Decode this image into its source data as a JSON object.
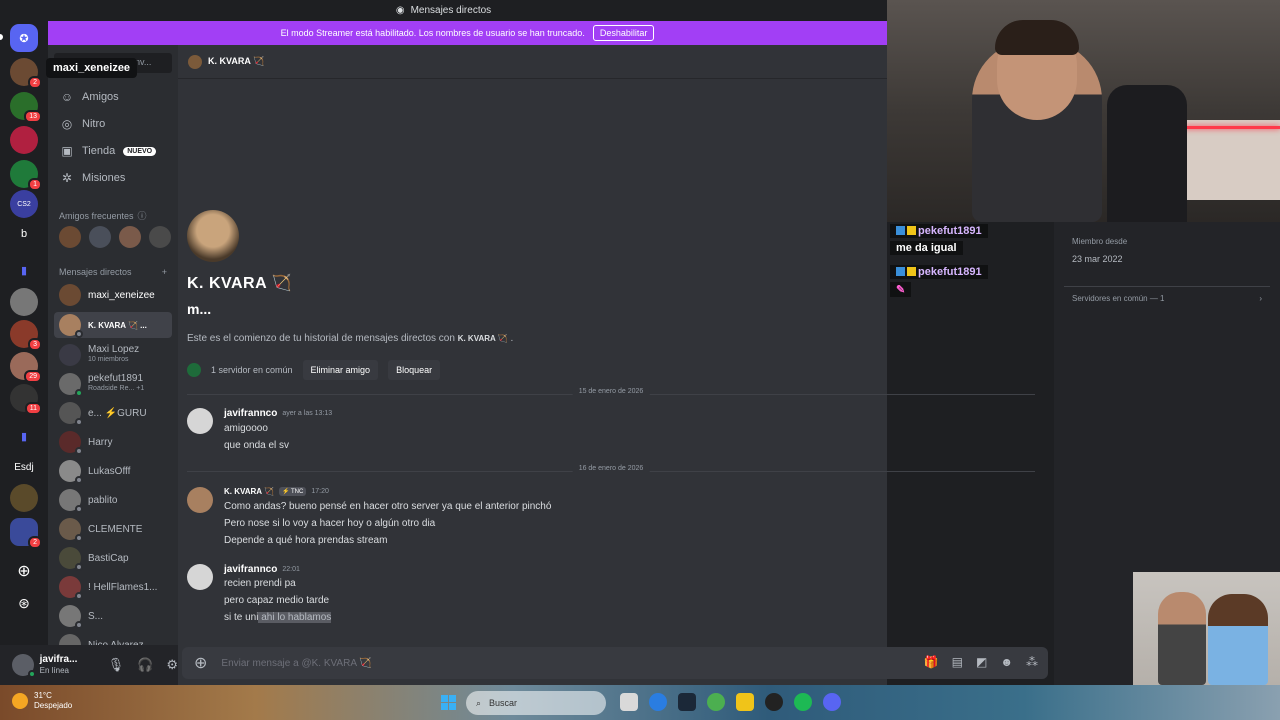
{
  "window": {
    "title": "Mensajes directos"
  },
  "banner": {
    "text": "El modo Streamer está habilitado. Los nombres de usuario se han truncado.",
    "button": "Deshabilitar"
  },
  "rail": {
    "tooltip": "maxi_xeneizee",
    "servers": [
      {
        "name": "discord-home",
        "badge": ""
      },
      {
        "name": "maxi_xeneizee",
        "badge": "2"
      },
      {
        "name": "guru",
        "badge": "13"
      },
      {
        "name": "server-3",
        "badge": ""
      },
      {
        "name": "server-4",
        "badge": "1"
      },
      {
        "name": "cs2",
        "badge": ""
      },
      {
        "name": "b",
        "label": "b",
        "badge": ""
      },
      {
        "name": "folder-1",
        "badge": ""
      },
      {
        "name": "server-8",
        "badge": ""
      },
      {
        "name": "server-9",
        "badge": "3"
      },
      {
        "name": "server-10",
        "badge": "29"
      },
      {
        "name": "server-11",
        "badge": "11"
      },
      {
        "name": "folder-2",
        "badge": ""
      },
      {
        "name": "esdj",
        "label": "Esdj",
        "badge": ""
      },
      {
        "name": "server-14",
        "badge": ""
      },
      {
        "name": "folder-3",
        "badge": "2"
      }
    ]
  },
  "sidebar": {
    "search_placeholder": "a conv...",
    "nav": [
      {
        "label": "Amigos",
        "icon": "friends-icon"
      },
      {
        "label": "Nitro",
        "icon": "nitro-icon"
      },
      {
        "label": "Tienda",
        "icon": "shop-icon",
        "badge": "NUEVO"
      },
      {
        "label": "Misiones",
        "icon": "quests-icon"
      }
    ],
    "frequent_title": "Amigos frecuentes",
    "dm_title": "Mensajes directos",
    "dms": [
      {
        "name": "maxi_xeneizee",
        "sub": ""
      },
      {
        "name": "K. KVARA 🏹 ...",
        "sub": "",
        "active": true
      },
      {
        "name": "Maxi Lopez",
        "sub": "10 miembros"
      },
      {
        "name": "pekefut1891",
        "sub": "Roadside Re... +1"
      },
      {
        "name": "e... ⚡GURU",
        "sub": ""
      },
      {
        "name": "Harry",
        "sub": ""
      },
      {
        "name": "LukasOfff",
        "sub": ""
      },
      {
        "name": "pablito",
        "sub": ""
      },
      {
        "name": "CLEMENTE",
        "sub": ""
      },
      {
        "name": "BastiCap",
        "sub": ""
      },
      {
        "name": "! HellFlames1...",
        "sub": ""
      },
      {
        "name": "S...",
        "sub": ""
      },
      {
        "name": "Nico Alvarez",
        "sub": ""
      }
    ]
  },
  "user": {
    "name": "javifra...",
    "status": "En línea"
  },
  "chat": {
    "header_name": "K. KVARA 🏹",
    "intro_name": "K. KVARA 🏹",
    "intro_sub": "m...",
    "intro_text_pre": "Este es el comienzo de tu historial de mensajes directos con",
    "intro_text_name": "K. KVARA 🏹",
    "intro_text_post": ".",
    "common_servers": "1 servidor en común",
    "remove_friend": "Eliminar amigo",
    "block": "Bloquear",
    "date1": "15 de enero de 2026",
    "date2": "16 de enero de 2026",
    "messages": [
      {
        "user": "javifrannco",
        "time": "ayer a las 13:13",
        "tag": "",
        "lines": [
          "amigoooo",
          "que onda el sv"
        ]
      },
      {
        "user": "K. KVARA 🏹",
        "time": "17:20",
        "tag": "⚡ TNC",
        "lines": [
          "Como andas? bueno pensé en hacer otro server ya que el anterior pinchó",
          "Pero nose si lo voy a hacer hoy o algún otro dia",
          "Depende a qué hora prendas stream"
        ]
      },
      {
        "user": "javifrannco",
        "time": "22:01",
        "tag": "",
        "lines": [
          "recien prendi pa",
          "pero capaz medio tarde"
        ],
        "last_pre": "si te uni",
        "last_sel": " ahi lo hablamos"
      }
    ],
    "composer_placeholder": "Enviar mensaje a @K. KVARA 🏹"
  },
  "profile": {
    "member_since_label": "Miembro desde",
    "member_since": "23 mar 2022",
    "common_servers": "Servidores en común — 1"
  },
  "overlay_chat": [
    {
      "name": "pekefut1891",
      "message": "me da igual"
    },
    {
      "name": "pekefut1891",
      "message": ""
    }
  ],
  "taskbar": {
    "temp": "31°C",
    "weather": "Despejado",
    "search": "Buscar"
  }
}
